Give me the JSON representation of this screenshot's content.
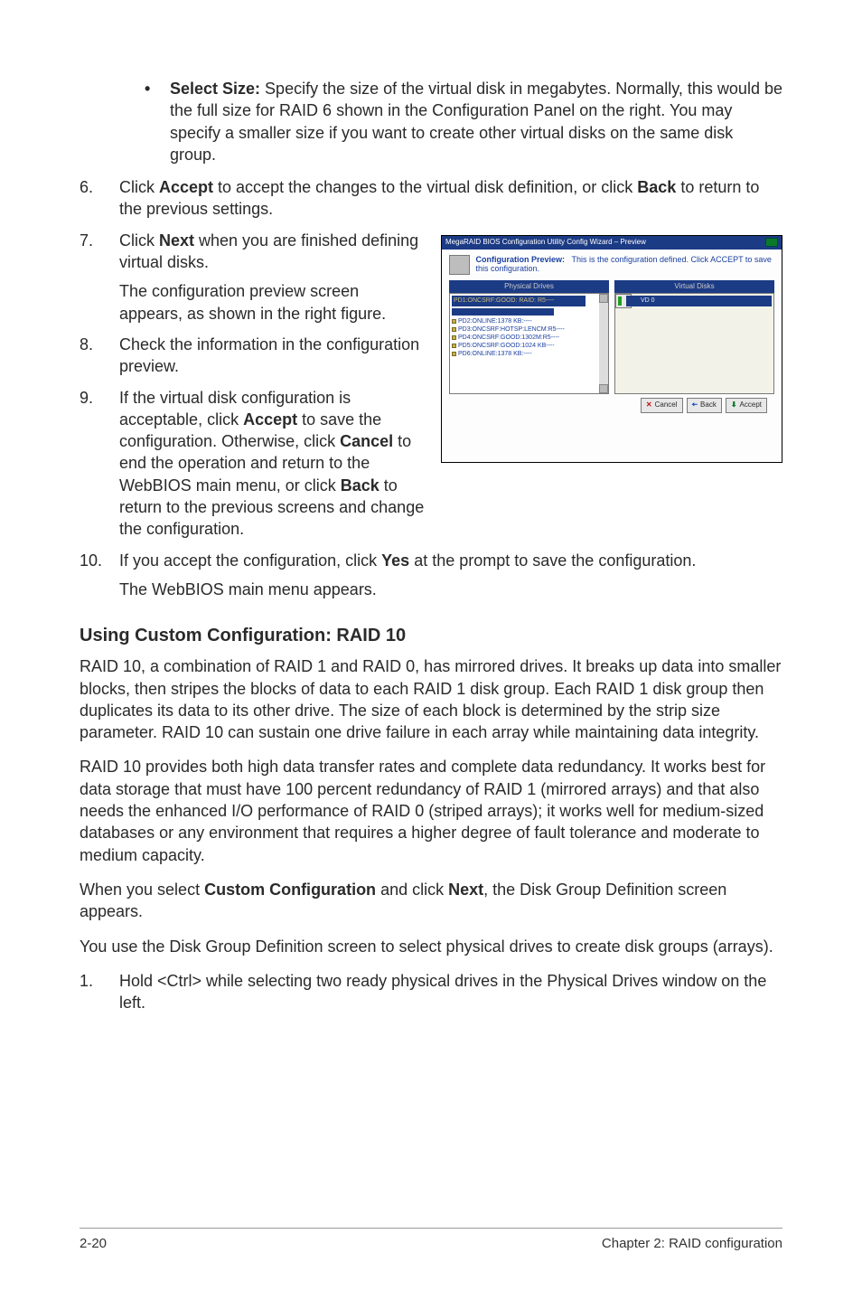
{
  "bullet": {
    "mark": "•",
    "label": "Select Size:",
    "text": " Specify the size of the virtual disk in megabytes. Normally, this would be the full size for RAID 6 shown in the Configuration Panel on the right. You may specify a smaller size if you want to create other virtual disks on the same disk group."
  },
  "steps": {
    "s6": {
      "num": "6.",
      "pre": "Click ",
      "b1": "Accept",
      "mid": " to accept the changes to the virtual disk definition, or click ",
      "b2": "Back",
      "post": " to return to the previous settings."
    },
    "s7": {
      "num": "7.",
      "pre": "Click ",
      "b1": "Next",
      "post": " when you are finished defining virtual disks.",
      "sub": "The configuration preview screen appears, as shown in the right figure."
    },
    "s8": {
      "num": "8.",
      "text": "Check the information in the configuration preview."
    },
    "s9": {
      "num": "9.",
      "pre": "If the virtual disk configuration is acceptable, click ",
      "b1": "Accept",
      "mid": " to save the configuration. Otherwise, click ",
      "b2": "Cancel",
      "mid2": " to end the operation and return to the WebBIOS main menu, or click ",
      "b3": "Back",
      "post": " to return to the previous screens and change the configuration."
    },
    "s10": {
      "num": "10.",
      "pre": "If you accept the configuration, click ",
      "b1": "Yes",
      "post": " at the prompt to save the configuration.",
      "sub": "The WebBIOS main menu appears."
    }
  },
  "section": {
    "heading": "Using Custom Configuration: RAID 10",
    "p1": "RAID 10, a combination of RAID 1 and RAID 0, has mirrored drives. It breaks up data into smaller blocks, then stripes the blocks of data to each RAID 1 disk group. Each RAID 1 disk group then duplicates its data to its other drive. The size of each block is determined by the strip size parameter. RAID 10 can sustain one drive failure in each array while maintaining data integrity.",
    "p2": "RAID 10 provides both high data transfer rates and complete data redundancy. It works best for data storage that must have 100 percent redundancy of RAID 1 (mirrored arrays) and that also needs the enhanced I/O performance of RAID 0 (striped arrays); it works well for medium-sized databases or any environment that requires a higher degree of fault tolerance and moderate to medium capacity.",
    "p3_pre": "When you select ",
    "p3_b1": "Custom Configuration",
    "p3_mid": " and click ",
    "p3_b2": "Next",
    "p3_post": ", the Disk Group Definition screen appears.",
    "p4": "You use the Disk Group Definition screen to select physical drives to create disk groups (arrays).",
    "step1": {
      "num": "1.",
      "text": "Hold <Ctrl> while selecting two ready physical drives in the Physical Drives window on the left."
    }
  },
  "figure": {
    "titlebar": "MegaRAID BIOS Configuration Utility Config Wizard – Preview",
    "head_label": "Configuration Preview:",
    "head_text": "This is the configuration defined. Click ACCEPT to save this configuration.",
    "left_title": "Physical Drives",
    "right_title": "Virtual Disks",
    "left_top": "PD1:ONCSRF:GOOD: RAID: R5----",
    "right_band": "VD 0",
    "btn_cancel": "Cancel",
    "btn_back": "Back",
    "btn_accept": "Accept",
    "left_lines": [
      "PD2:ONLINE:1378 KB:----",
      "PD3:ONCSRF:HOTSP:LENCM:R5----",
      "PD4:ONCSRF:GOOD:1302M:R5----",
      "PD5:ONCSRF:GOOD:1024 KB----",
      "PD6:ONLINE:1378 KB:----"
    ]
  },
  "footer": {
    "left": "2-20",
    "right": "Chapter 2: RAID configuration"
  }
}
